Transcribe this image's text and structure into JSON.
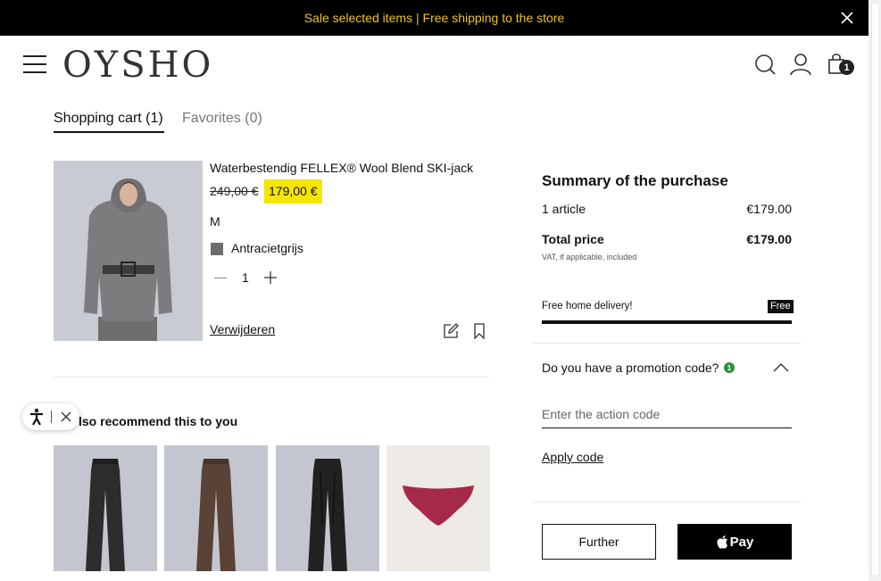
{
  "banner": {
    "text": "Sale selected items | Free shipping to the store"
  },
  "header": {
    "logo": "OYSHO",
    "cart_count": "1"
  },
  "tabs": {
    "cart": "Shopping cart (1)",
    "favorites": "Favorites (0)"
  },
  "product": {
    "name": "Waterbestendig FELLEX® Wool Blend SKI-jack",
    "old_price": "249,00 €",
    "new_price": "179,00 €",
    "size": "M",
    "color": "Antracietgrijs",
    "quantity": "1",
    "remove_label": "Verwijderen"
  },
  "recommendations": {
    "title": "lso recommend this to you"
  },
  "summary": {
    "title": "Summary of the purchase",
    "articles_label": "1 article",
    "articles_value": "€179.00",
    "total_label": "Total price",
    "total_value": "€179.00",
    "vat_note": "VAT, if applicable, included",
    "delivery_label": "Free home delivery!",
    "delivery_badge": "Free",
    "promo_question": "Do you have a promotion code?",
    "promo_count": "1",
    "promo_placeholder": "Enter the action code",
    "apply_label": "Apply code",
    "further_label": "Further",
    "applepay_label": "Pay"
  },
  "colors": {
    "banner_text": "#f0c419",
    "price_highlight": "#f5e600",
    "promo_dot": "#2c8f3c"
  }
}
